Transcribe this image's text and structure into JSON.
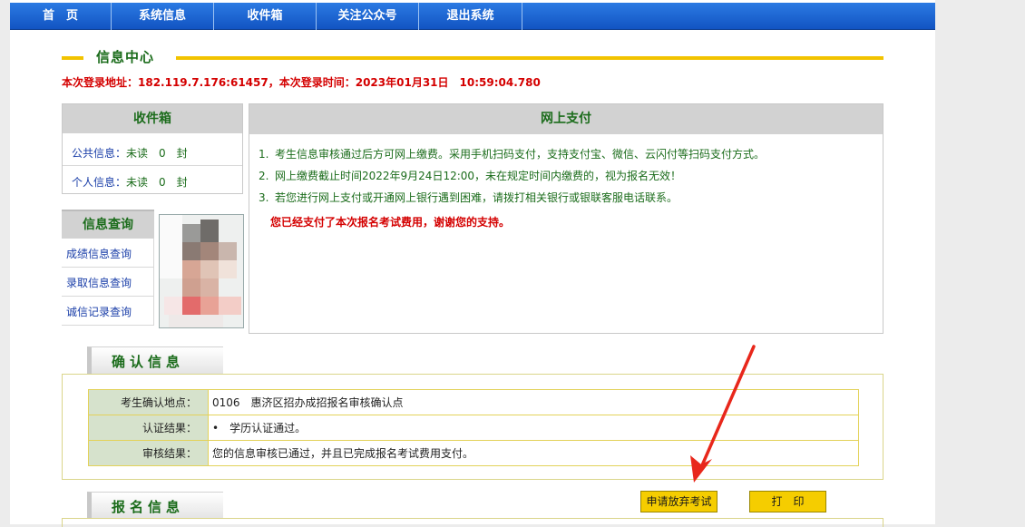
{
  "nav": {
    "home": "首　页",
    "system_info": "系统信息",
    "inbox": "收件箱",
    "follow": "关注公众号",
    "logout": "退出系统"
  },
  "info_center": {
    "title": "信息中心",
    "login_info": "本次登录地址：182.119.7.176:61457，本次登录时间：2023年01月31日　10:59:04.780"
  },
  "inbox": {
    "title": "收件箱",
    "public_label": "公共信息：",
    "public_value": "未读　0　封",
    "private_label": "个人信息：",
    "private_value": "未读　0　封"
  },
  "query": {
    "title": "信息查询",
    "items": [
      "成绩信息查询",
      "录取信息查询",
      "诚信记录查询"
    ]
  },
  "payment": {
    "title": "网上支付",
    "items": [
      "考生信息审核通过后方可网上缴费。采用手机扫码支付，支持支付宝、微信、云闪付等扫码支付方式。",
      "网上缴费截止时间2022年9月24日12:00，未在规定时间内缴费的，视为报名无效！",
      "若您进行网上支付或开通网上银行遇到困难，请拨打相关银行或银联客服电话联系。"
    ],
    "numbers": [
      "1.",
      "2.",
      "3."
    ],
    "paid_note": "您已经支付了本次报名考试费用，谢谢您的支持。"
  },
  "confirm": {
    "title": "确认信息",
    "rows": [
      {
        "label": "考生确认地点：",
        "value": "0106　惠济区招办成招报名审核确认点"
      },
      {
        "label": "认证结果：",
        "value": "•　学历认证通过。"
      },
      {
        "label": "审核结果：",
        "value": "您的信息审核已通过，并且已完成报名考试费用支付。"
      }
    ]
  },
  "registration": {
    "title": "报名信息"
  },
  "buttons": {
    "abandon": "申请放弃考试",
    "print": "打　印"
  },
  "colors": {
    "nav_blue": "#1a63d2",
    "title_green": "#1b6c1b",
    "alert_red": "#d40000",
    "accent_yellow": "#f2c300",
    "annotation_red": "#e8271b"
  }
}
